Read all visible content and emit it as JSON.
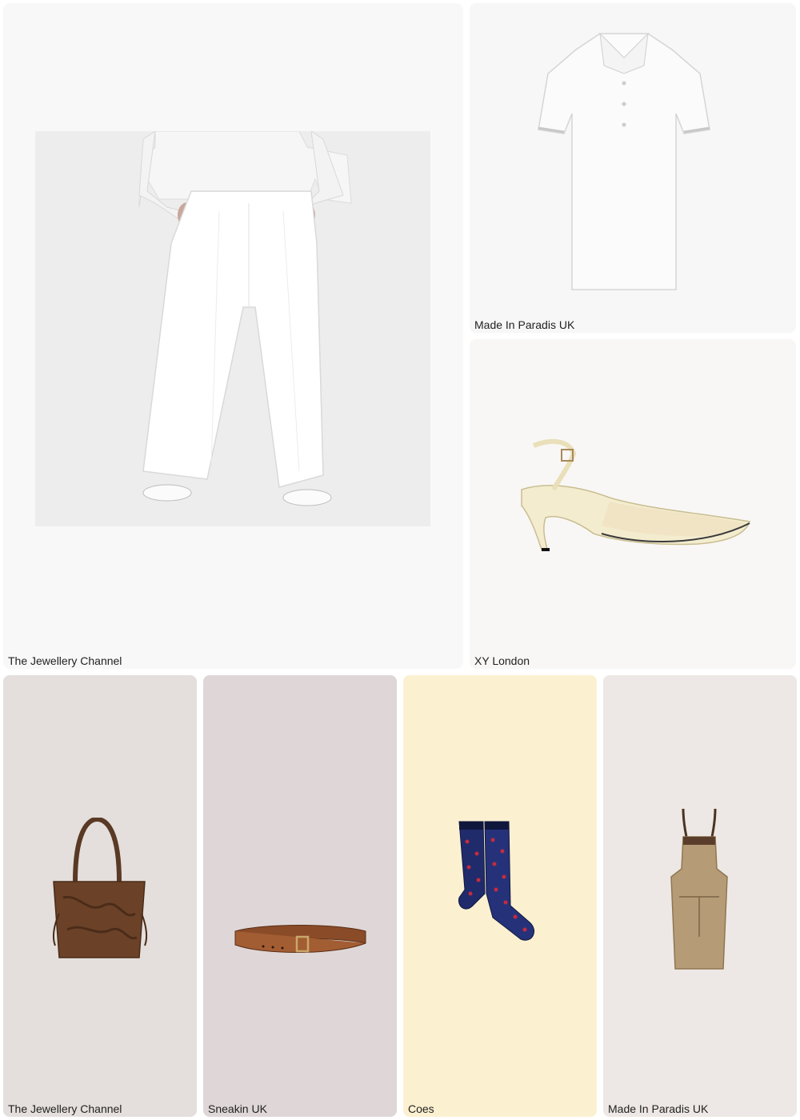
{
  "products": [
    {
      "brand": "The Jewellery Channel",
      "item_icon": "wide-leg-trousers-photo"
    },
    {
      "brand": "Made In Paradis UK",
      "item_icon": "polo-shirt-photo"
    },
    {
      "brand": "XY London",
      "item_icon": "slingback-heel-photo"
    },
    {
      "brand": "The Jewellery Channel",
      "item_icon": "tote-bag-photo"
    },
    {
      "brand": "Sneakin UK",
      "item_icon": "leather-belt-photo"
    },
    {
      "brand": "Coes",
      "item_icon": "socks-photo"
    },
    {
      "brand": "Made In Paradis UK",
      "item_icon": "apron-photo"
    }
  ],
  "colors": {
    "card_backgrounds": [
      "#f8f8f9",
      "#f7f7f8",
      "#f8f7f5",
      "#e4dfdc",
      "#dfd7d7",
      "#fbf0d0",
      "#ede8e5"
    ],
    "label_text": "#222222"
  }
}
